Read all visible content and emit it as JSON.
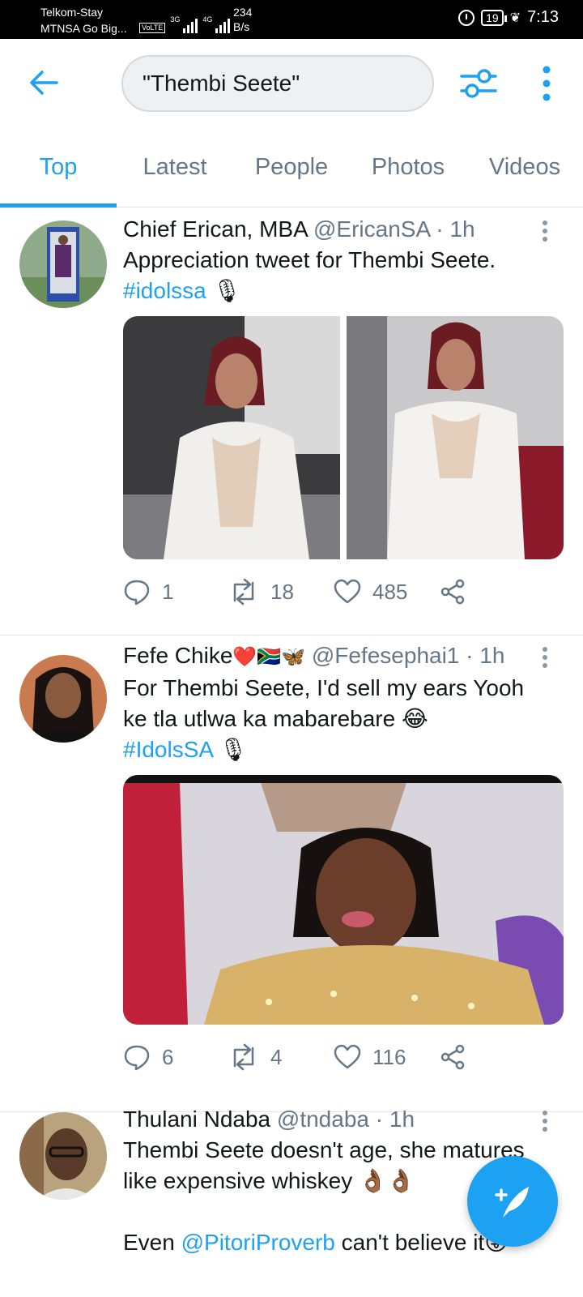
{
  "status_bar": {
    "carrier_line1": "Telkom-Stay",
    "carrier_line2": "MTNSA Go Big...",
    "volte": "VoLTE",
    "net1": "3G",
    "net2": "4G",
    "speed_value": "234",
    "speed_unit": "B/s",
    "battery": "19",
    "time": "7:13"
  },
  "search": {
    "query": "\"Thembi Seete\""
  },
  "tabs": [
    {
      "label": "Top",
      "active": true
    },
    {
      "label": "Latest",
      "active": false
    },
    {
      "label": "People",
      "active": false
    },
    {
      "label": "Photos",
      "active": false
    },
    {
      "label": "Videos",
      "active": false
    }
  ],
  "tweets": [
    {
      "name": "Chief Erican, MBA",
      "handle": "@EricanSA",
      "time": "· 1h",
      "text_pre": "Appreciation tweet for ",
      "text_hl": "Thembi Seete",
      "text_post": ".",
      "hashtag": "#idolssa",
      "replies": "1",
      "retweets": "18",
      "likes": "485"
    },
    {
      "name": "Fefe Chike",
      "name_emoji": "❤️🇿🇦🦋",
      "handle": "@Fefesephai1",
      "time": "· 1h",
      "text_pre": "For ",
      "text_hl": "Thembi Seete",
      "text_post": ", I'd sell my ears Yooh ke tla utlwa ka mabarebare 😂",
      "hashtag": "#IdolsSA",
      "replies": "6",
      "retweets": "4",
      "likes": "116"
    },
    {
      "name": "Thulani Ndaba",
      "handle": "@tndaba",
      "time": "· 1h",
      "text_hl": "Thembi Seete",
      "text_post": " doesn't age, she matures like expensive whiskey 👌🏾👌🏾",
      "line2_pre": "Even ",
      "mention": "@PitoriProverb",
      "line2_post": " can't believe it😛"
    }
  ],
  "colors": {
    "accent": "#1da1f2",
    "text": "#14171a",
    "muted": "#657786",
    "divider": "#e1e8ed"
  }
}
